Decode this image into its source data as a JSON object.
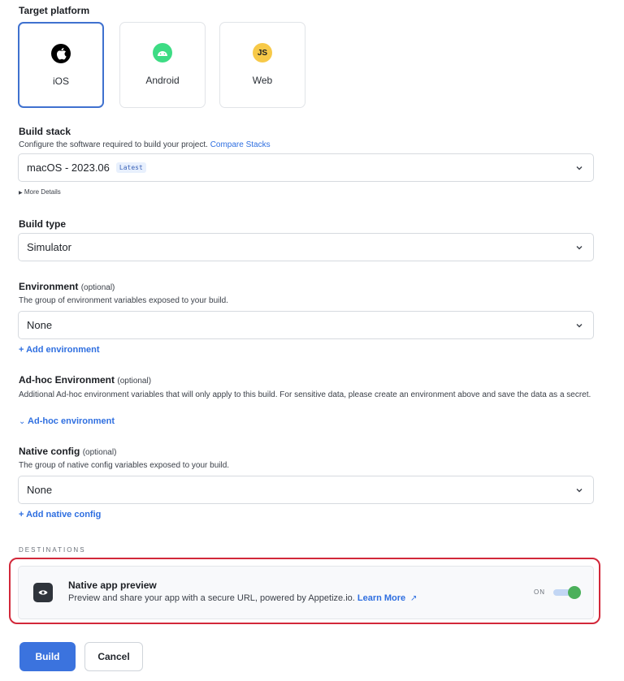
{
  "target_platform": {
    "title": "Target platform",
    "options": [
      {
        "label": "iOS",
        "icon": "apple-icon",
        "selected": true
      },
      {
        "label": "Android",
        "icon": "android-icon",
        "selected": false
      },
      {
        "label": "Web",
        "icon": "js-icon",
        "icon_text": "JS",
        "selected": false
      }
    ]
  },
  "build_stack": {
    "title": "Build stack",
    "help": "Configure the software required to build your project.",
    "help_link": "Compare Stacks",
    "value": "macOS - 2023.06",
    "badge": "Latest",
    "more_details": "More Details"
  },
  "build_type": {
    "title": "Build type",
    "value": "Simulator"
  },
  "environment": {
    "title": "Environment",
    "optional": "(optional)",
    "help": "The group of environment variables exposed to your build.",
    "value": "None",
    "add_link": "+ Add environment"
  },
  "adhoc_environment": {
    "title": "Ad-hoc Environment",
    "optional": "(optional)",
    "help": "Additional Ad-hoc environment variables that will only apply to this build. For sensitive data, please create an environment above and save the data as a secret.",
    "toggle_link": "Ad-hoc environment"
  },
  "native_config": {
    "title": "Native config",
    "optional": "(optional)",
    "help": "The group of native config variables exposed to your build.",
    "value": "None",
    "add_link": "+ Add native config"
  },
  "destinations": {
    "label": "DESTINATIONS",
    "items": [
      {
        "title": "Native app preview",
        "description": "Preview and share your app with a secure URL, powered by Appetize.io.",
        "link": "Learn More",
        "toggle_label": "ON",
        "enabled": true,
        "icon": "eye-icon"
      }
    ]
  },
  "actions": {
    "build": "Build",
    "cancel": "Cancel"
  },
  "colors": {
    "accent": "#3b73de",
    "link": "#2f6fe0",
    "highlight": "#d2283a",
    "toggle_on": "#4bb05b",
    "android": "#3ddc84",
    "js": "#f7c948"
  }
}
